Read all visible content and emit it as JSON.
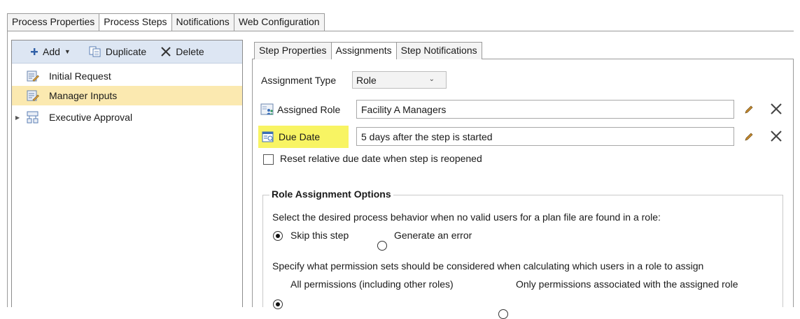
{
  "top_tabs": [
    {
      "label": "Process Properties",
      "active": false
    },
    {
      "label": "Process Steps",
      "active": true
    },
    {
      "label": "Notifications",
      "active": false
    },
    {
      "label": "Web Configuration",
      "active": false
    }
  ],
  "left_panel": {
    "toolbar": {
      "add_label": "Add",
      "duplicate_label": "Duplicate",
      "delete_label": "Delete"
    },
    "tree_items": [
      {
        "label": "Initial Request",
        "selected": false,
        "expandable": false,
        "icon": "step-edit-icon"
      },
      {
        "label": "Manager Inputs",
        "selected": true,
        "expandable": false,
        "icon": "step-edit-icon"
      },
      {
        "label": "Executive Approval",
        "selected": false,
        "expandable": true,
        "icon": "approval-step-icon"
      }
    ]
  },
  "inner_tabs": [
    {
      "label": "Step Properties",
      "active": false
    },
    {
      "label": "Assignments",
      "active": true
    },
    {
      "label": "Step Notifications",
      "active": false
    }
  ],
  "assignments": {
    "assignment_type_label": "Assignment Type",
    "assignment_type_value": "Role",
    "assigned_role_label": "Assigned Role",
    "assigned_role_value": "Facility A Managers",
    "due_date_label": "Due Date",
    "due_date_value": "5 days after the step is started",
    "reset_checkbox_label": "Reset relative due date when step is reopened",
    "reset_checked": false
  },
  "role_options": {
    "title": "Role Assignment Options",
    "no_users_prompt": "Select the desired process behavior when no valid users for a plan file are found in a role:",
    "no_users_options": [
      {
        "label": "Skip this step",
        "selected": true
      },
      {
        "label": "Generate an error",
        "selected": false
      }
    ],
    "permissions_prompt": "Specify what permission sets should be considered when calculating which users in a role to assign",
    "permissions_options": [
      {
        "label": "All permissions (including other roles)",
        "selected": true
      },
      {
        "label": "Only permissions associated with the assigned role",
        "selected": false
      }
    ]
  },
  "colors": {
    "toolbar_bg": "#dde6f3",
    "selected_row": "#fbe9b0",
    "highlight": "#f8f463"
  }
}
